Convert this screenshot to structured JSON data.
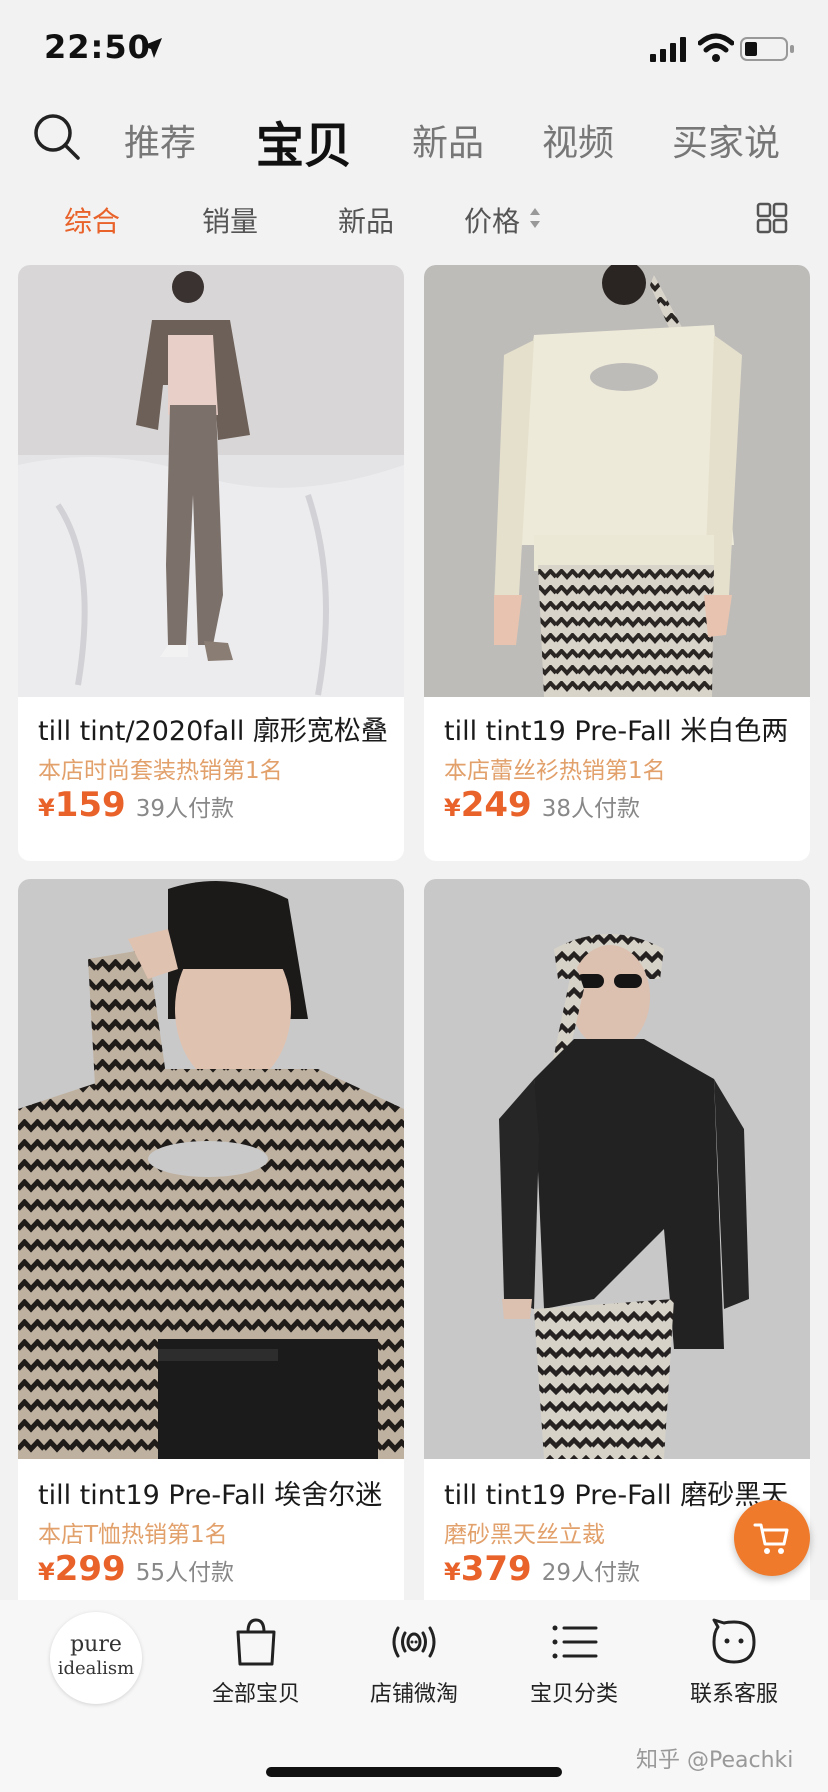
{
  "status": {
    "time": "22:50"
  },
  "nav": {
    "tabs": [
      {
        "label": "推荐"
      },
      {
        "label": "宝贝"
      },
      {
        "label": "新品"
      },
      {
        "label": "视频"
      },
      {
        "label": "买家说"
      }
    ],
    "active_tab": "宝贝"
  },
  "sort": {
    "items": [
      {
        "label": "综合"
      },
      {
        "label": "销量"
      },
      {
        "label": "新品"
      },
      {
        "label": "价格"
      }
    ],
    "active": "综合"
  },
  "products": [
    {
      "title": "till tint/2020fall 廓形宽松叠",
      "tag": "本店时尚套装热销第1名",
      "currency": "¥",
      "price": "159",
      "sold": "39人付款"
    },
    {
      "title": "till tint19 Pre-Fall 米白色两",
      "tag": "本店蕾丝衫热销第1名",
      "currency": "¥",
      "price": "249",
      "sold": "38人付款"
    },
    {
      "title": "till tint19 Pre-Fall 埃舍尔迷",
      "tag": "本店T恤热销第1名",
      "currency": "¥",
      "price": "299",
      "sold": "55人付款"
    },
    {
      "title": "till tint19 Pre-Fall 磨砂黑天",
      "tag": "磨砂黑天丝立裁",
      "currency": "¥",
      "price": "379",
      "sold": "29人付款"
    }
  ],
  "bottom_bar": {
    "logo_text": [
      "pure",
      "idealism"
    ],
    "items": [
      {
        "label": "全部宝贝",
        "icon": "shopping-bag-icon"
      },
      {
        "label": "店铺微淘",
        "icon": "broadcast-icon"
      },
      {
        "label": "宝贝分类",
        "icon": "list-icon"
      },
      {
        "label": "联系客服",
        "icon": "chat-face-icon"
      }
    ]
  },
  "watermark": "知乎 @Peachki",
  "colors": {
    "accent": "#e8622a",
    "tag": "#e2a06b",
    "cart": "#f07a2b"
  }
}
